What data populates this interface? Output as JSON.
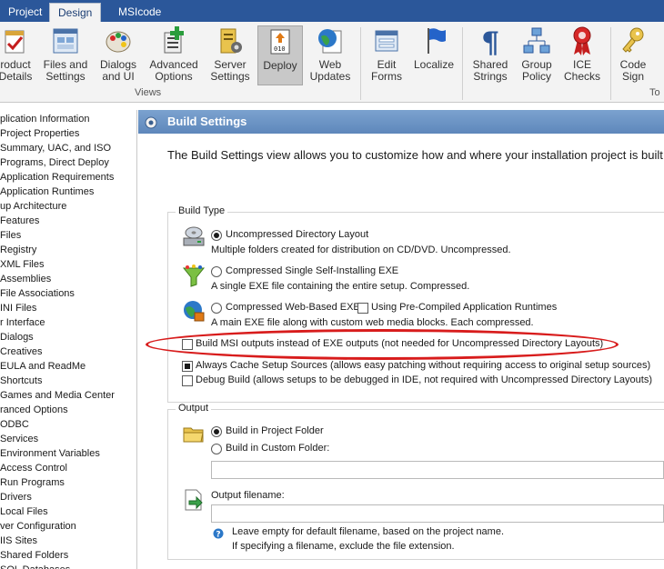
{
  "tabs": [
    {
      "label": "Project"
    },
    {
      "label": "Design"
    },
    {
      "label": "MSIcode"
    }
  ],
  "ribbon": {
    "buttons": [
      {
        "label": "roduct\nDetails",
        "icon": "product-details-icon"
      },
      {
        "label": "Files and\nSettings",
        "icon": "files-settings-icon"
      },
      {
        "label": "Dialogs\nand UI",
        "icon": "palette-icon"
      },
      {
        "label": "Advanced\nOptions",
        "icon": "advanced-options-icon"
      },
      {
        "label": "Server\nSettings",
        "icon": "server-settings-icon"
      },
      {
        "label": "Deploy",
        "icon": "deploy-icon"
      },
      {
        "label": "Web\nUpdates",
        "icon": "web-updates-icon"
      },
      {
        "label": "Edit\nForms",
        "icon": "edit-forms-icon"
      },
      {
        "label": "Localize",
        "icon": "flag-icon"
      },
      {
        "label": "Shared\nStrings",
        "icon": "pilcrow-icon"
      },
      {
        "label": "Group\nPolicy",
        "icon": "network-icon"
      },
      {
        "label": "ICE\nChecks",
        "icon": "ribbon-award-icon"
      },
      {
        "label": "Code\nSign",
        "icon": "key-icon"
      }
    ],
    "group_views": "Views",
    "group_tools": "To"
  },
  "tree": {
    "items": [
      "plication Information",
      "Project Properties",
      "Summary, UAC, and ISO",
      "Programs, Direct Deploy",
      "Application Requirements",
      "Application Runtimes",
      "up Architecture",
      "Features",
      "Files",
      "Registry",
      "XML Files",
      "Assemblies",
      "File Associations",
      "INI Files",
      "r Interface",
      "Dialogs",
      "Creatives",
      "EULA and ReadMe",
      "Shortcuts",
      "Games and Media Center",
      "ranced Options",
      "ODBC",
      "Services",
      "Environment Variables",
      "Access Control",
      "Run Programs",
      "Drivers",
      "Local Files",
      "ver Configuration",
      "IIS Sites",
      "Shared Folders",
      "SQL Databases"
    ]
  },
  "panel": {
    "title": "Build Settings",
    "intro": "The Build Settings view allows you to customize how and where your installation project is built"
  },
  "build_type": {
    "title": "Build Type",
    "uncompressed_label": "Uncompressed Directory Layout",
    "uncompressed_desc": "Multiple folders created for distribution on CD/DVD. Uncompressed.",
    "single_exe_label": "Compressed Single Self-Installing EXE",
    "single_exe_desc": "A single EXE file containing the entire setup. Compressed.",
    "web_label": "Compressed Web-Based EXE",
    "precompiled_label": "Using Pre-Compiled Application Runtimes",
    "web_desc": "A main EXE file along with custom web media blocks. Each compressed.",
    "msi_label": "Build MSI outputs instead of EXE outputs (not needed for Uncompressed Directory Layouts)",
    "cache_label": "Always Cache Setup Sources (allows easy patching without requiring access to original setup sources)",
    "debug_label": "Debug Build (allows setups to be debugged in IDE, not required with Uncompressed Directory Layouts)",
    "selected": "uncompressed",
    "msi_checked": false,
    "cache_checked": true,
    "debug_checked": false,
    "precompiled_checked": false
  },
  "output": {
    "title": "Output",
    "project_folder_label": "Build in Project Folder",
    "custom_folder_label": "Build in Custom Folder:",
    "custom_folder_value": "",
    "filename_label": "Output filename:",
    "filename_value": "",
    "hint_line1": "Leave empty for default filename, based on the project name.",
    "hint_line2": "If specifying a filename, exclude the file extension."
  },
  "colors": {
    "tab_bar": "#2b579a",
    "panel_header": "#6a93c5",
    "annotation": "#d81c1c"
  }
}
